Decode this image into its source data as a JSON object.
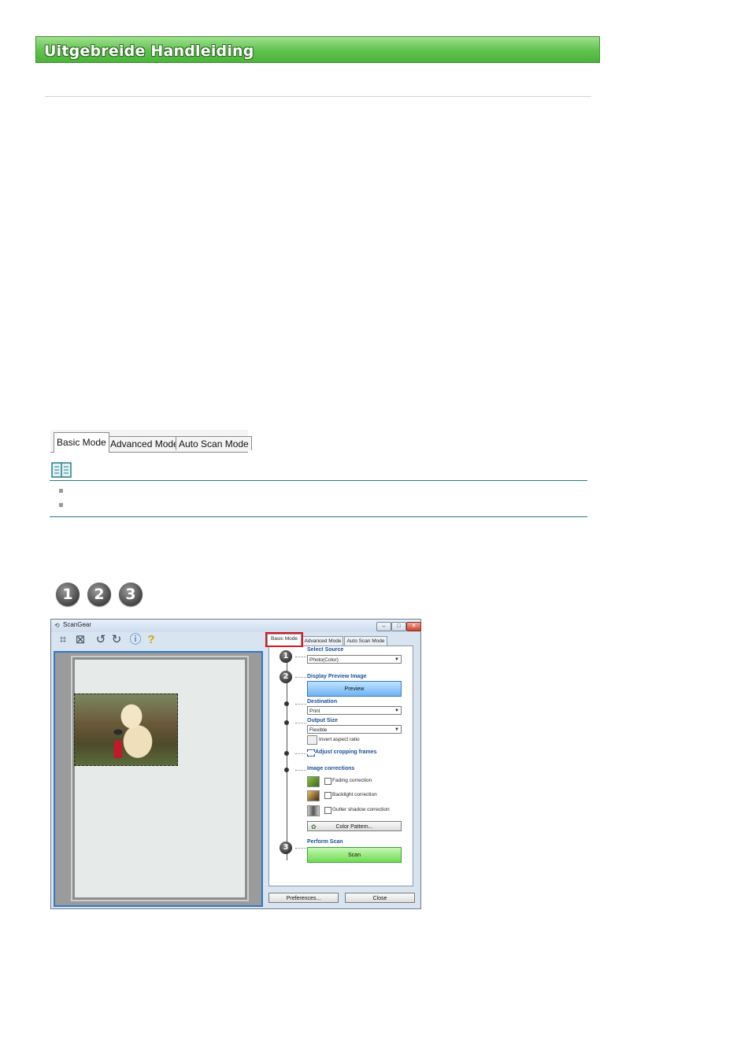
{
  "manual": {
    "banner_title": "Uitgebreide Handleiding"
  },
  "mode_tabs": [
    "Basic Mode",
    "Advanced Mode",
    "Auto Scan Mode"
  ],
  "step_numbers": [
    "1",
    "2",
    "3"
  ],
  "scangear": {
    "window_title": "ScanGear",
    "tabs": [
      "Basic Mode",
      "Advanced Mode",
      "Auto Scan Mode"
    ],
    "steps": {
      "step1": {
        "number": "1",
        "label": "Select Source",
        "value": "Photo(Color)"
      },
      "step2": {
        "number": "2",
        "label": "Display Preview Image",
        "button": "Preview"
      },
      "destination": {
        "label": "Destination",
        "value": "Print"
      },
      "output_size": {
        "label": "Output Size",
        "value": "Flexible",
        "invert_label": "Invert aspect ratio"
      },
      "adjust_link": "Adjust cropping frames",
      "image_corrections": {
        "label": "Image corrections",
        "items": [
          "Fading correction",
          "Backlight correction",
          "Gutter shadow correction"
        ],
        "color_pattern": "Color Pattern..."
      },
      "step3": {
        "number": "3",
        "label": "Perform Scan",
        "button": "Scan"
      }
    },
    "footer": {
      "preferences": "Preferences...",
      "close": "Close"
    }
  }
}
